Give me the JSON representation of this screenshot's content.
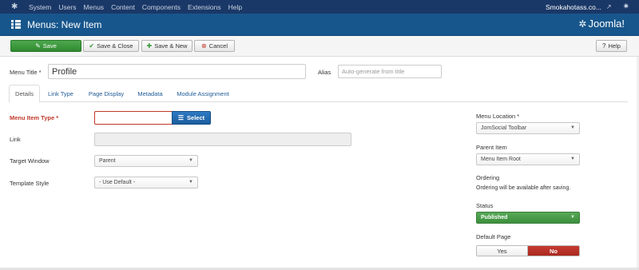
{
  "topnav": {
    "items": [
      "System",
      "Users",
      "Menus",
      "Content",
      "Components",
      "Extensions",
      "Help"
    ],
    "site_name": "Smokahotass.co...",
    "external_icon": "external-link-icon",
    "settings_icon": "gear-icon"
  },
  "header": {
    "title": "Menus: New Item",
    "brand": "Joomla!"
  },
  "toolbar": {
    "save": "Save",
    "save_close": "Save & Close",
    "save_new": "Save & New",
    "cancel": "Cancel",
    "help": "Help"
  },
  "form": {
    "menu_title_label": "Menu Title *",
    "menu_title_value": "Profile",
    "alias_label": "Alias",
    "alias_placeholder": "Auto-generate from title"
  },
  "tabs": [
    "Details",
    "Link Type",
    "Page Display",
    "Metadata",
    "Module Assignment"
  ],
  "details": {
    "menu_item_type_label": "Menu Item Type *",
    "select_button": "Select",
    "link_label": "Link",
    "target_window_label": "Target Window",
    "target_window_value": "Parent",
    "template_style_label": "Template Style",
    "template_style_value": "- Use Default -"
  },
  "sidebar": {
    "menu_location_label": "Menu Location *",
    "menu_location_value": "JomSocial Toolbar",
    "parent_item_label": "Parent Item",
    "parent_item_value": "Menu Item Root",
    "ordering_label": "Ordering",
    "ordering_note": "Ordering will be available after saving.",
    "status_label": "Status",
    "status_value": "Published",
    "default_page_label": "Default Page",
    "yes": "Yes",
    "no": "No"
  },
  "colors": {
    "topnav_bg": "#1a3867",
    "header_bg": "#17568c",
    "save_green": "#3a9a3a",
    "select_blue": "#1f63a6",
    "published_green": "#4a9e4a",
    "no_red": "#b8322a"
  }
}
